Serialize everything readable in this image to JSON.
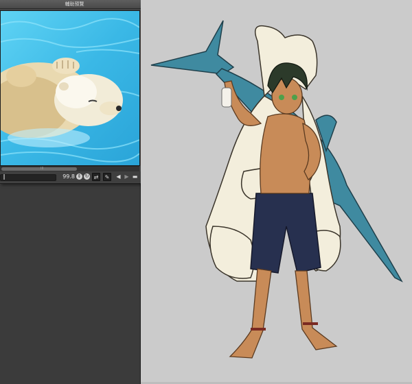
{
  "palette": {
    "title": "輔助預覽",
    "close_glyph": "×",
    "scroll_grip": "III"
  },
  "toolbar": {
    "zoom_value": "99.8",
    "icons": [
      "zoom-stepper-icon",
      "rotate-icon",
      "flip-icon",
      "eyedropper-icon",
      "previous-image-icon",
      "next-image-icon",
      "open-image-icon",
      "delete-image-icon"
    ]
  },
  "colors": {
    "canvas_bg": "#cbcbcb",
    "workspace_bg": "#3b3b3b",
    "water": "#4cc6ee",
    "marlin": "#3f8aa0",
    "bear_hood": "#f3eedc",
    "shorts": "#27304f",
    "hair": "#2c3a2a",
    "skin": "#c88b58"
  }
}
